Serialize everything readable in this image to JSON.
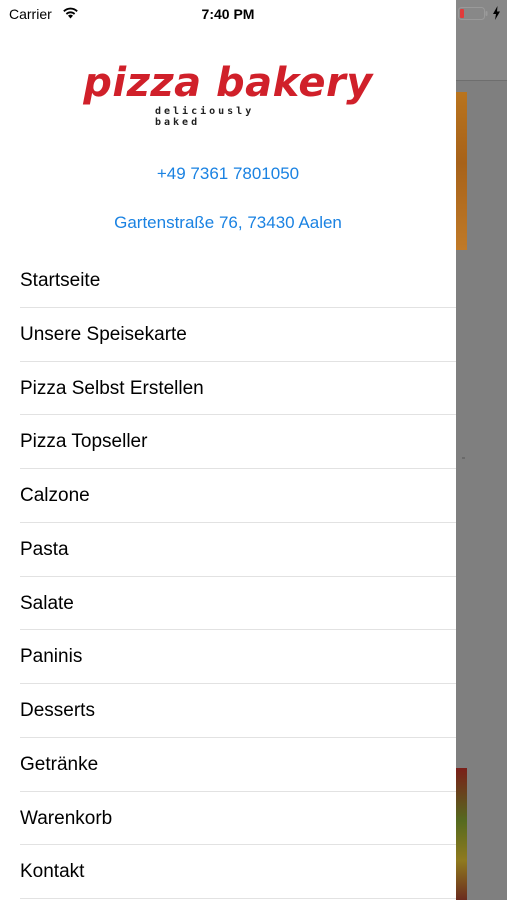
{
  "status_bar": {
    "carrier": "Carrier",
    "time": "7:40 PM"
  },
  "drawer": {
    "logo": {
      "wordmark": "pizza bakery",
      "tagline": "deliciously baked",
      "color": "#d0202a"
    },
    "phone": "+49 7361 7801050",
    "address": "Gartenstraße 76, 73430 Aalen",
    "link_color": "#1a82e2",
    "menu_items": [
      {
        "label": "Startseite"
      },
      {
        "label": "Unsere Speisekarte"
      },
      {
        "label": "Pizza Selbst Erstellen"
      },
      {
        "label": "Pizza Topseller"
      },
      {
        "label": "Calzone"
      },
      {
        "label": "Pasta"
      },
      {
        "label": "Salate"
      },
      {
        "label": "Paninis"
      },
      {
        "label": "Desserts"
      },
      {
        "label": "Getränke"
      },
      {
        "label": "Warenkorb"
      },
      {
        "label": "Kontakt"
      }
    ]
  }
}
